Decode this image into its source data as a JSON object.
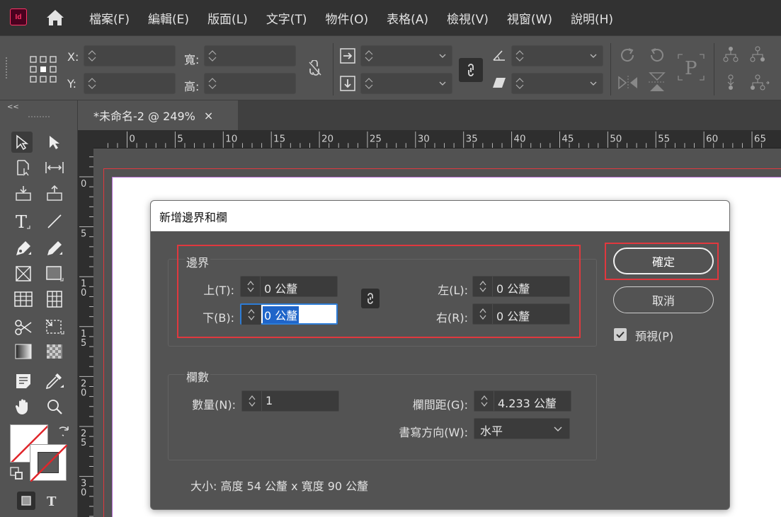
{
  "app": {
    "logo_text": "Id"
  },
  "menu": [
    "檔案(F)",
    "編輯(E)",
    "版面(L)",
    "文字(T)",
    "物件(O)",
    "表格(A)",
    "檢視(V)",
    "視窗(W)",
    "說明(H)"
  ],
  "control_bar": {
    "x_label": "X:",
    "y_label": "Y:",
    "w_label": "寬:",
    "h_label": "高:"
  },
  "document": {
    "tab_title": "*未命名-2 @ 249%",
    "tab_close": "×",
    "toolbox_collapse": "<<"
  },
  "ruler": {
    "top_labels": [
      "0",
      "5",
      "10",
      "15",
      "20",
      "25",
      "30",
      "35",
      "40",
      "45",
      "50",
      "55",
      "60",
      "65"
    ],
    "left_labels": [
      "0",
      "5",
      "1\n0",
      "1\n5",
      "2\n0",
      "2\n5",
      "3\n0"
    ]
  },
  "dialog": {
    "title": "新增邊界和欄",
    "margins": {
      "title": "邊界",
      "top_label": "上(T):",
      "top_value": "0 公釐",
      "bottom_label": "下(B):",
      "bottom_value": "0 公釐",
      "left_label": "左(L):",
      "left_value": "0 公釐",
      "right_label": "右(R):",
      "right_value": "0 公釐"
    },
    "columns": {
      "title": "欄數",
      "number_label": "數量(N):",
      "number_value": "1",
      "gutter_label": "欄間距(G):",
      "gutter_value": "4.233 公釐",
      "direction_label": "書寫方向(W):",
      "direction_value": "水平"
    },
    "ok_label": "確定",
    "cancel_label": "取消",
    "preview_label": "預視(P)",
    "preview_checked": true,
    "size_info": "大小:  高度 54 公釐 x 寬度 90 公釐"
  },
  "colors": {
    "highlight": "#e0383e",
    "focus": "#1f65c9",
    "brand": "#ff3366"
  }
}
